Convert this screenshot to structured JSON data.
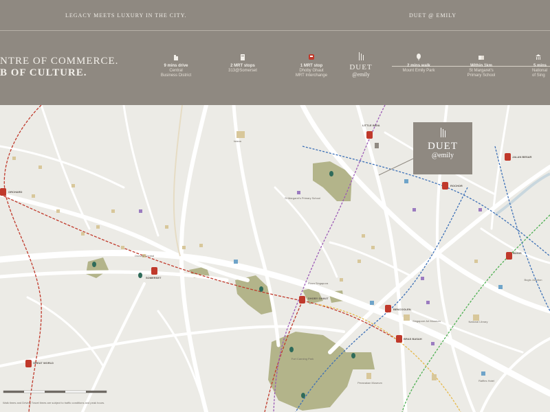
{
  "header": {
    "tagline": "LEGACY MEETS LUXURY IN THE CITY.",
    "brand": "DUET @ EMILY"
  },
  "band": {
    "headline_line1": "NTRE OF COMMERCE.",
    "headline_line2": "B OF CULTURE.",
    "logo_main": "DUET",
    "logo_sub": "@emily",
    "features": [
      {
        "icon": "building-icon",
        "line1": "9 mins drive",
        "line2": "Central",
        "line3": "Business District"
      },
      {
        "icon": "building-icon",
        "line1": "2 MRT stops",
        "line2": "313@Somerset",
        "line3": ""
      },
      {
        "icon": "train-icon",
        "line1": "1 MRT stop",
        "line2": "Dhoby Ghaut",
        "line3": "MRT Interchange"
      },
      {
        "icon": "pin-icon",
        "line1": "2 mins walk",
        "line2": "Mount Emily Park",
        "line3": ""
      },
      {
        "icon": "book-icon",
        "line1": "Within 1km",
        "line2": "St Margaret's",
        "line3": "Primary School"
      },
      {
        "icon": "museum-icon",
        "line1": "5 mins",
        "line2": "National",
        "line3": "of Sing"
      }
    ]
  },
  "callout": {
    "main": "DUET",
    "sub": "@emily"
  },
  "stations": [
    {
      "name": "ORCHARD"
    },
    {
      "name": "SOMERSET"
    },
    {
      "name": "DHOBY GHAUT"
    },
    {
      "name": "LITTLE INDIA"
    },
    {
      "name": "ROCHOR"
    },
    {
      "name": "JALAN BESAR"
    },
    {
      "name": "BUGIS"
    },
    {
      "name": "BENCOOLEN"
    },
    {
      "name": "BRAS BASAH"
    },
    {
      "name": "GREAT WORLD"
    }
  ],
  "places": [
    {
      "name": "Istana"
    },
    {
      "name": "St Margaret's Primary School"
    },
    {
      "name": "Orchard Central"
    },
    {
      "name": "Singapore Art Museum"
    },
    {
      "name": "National Library"
    },
    {
      "name": "Bugis Junction"
    },
    {
      "name": "Peranakan Museum"
    },
    {
      "name": "Fort Canning Park"
    },
    {
      "name": "Plaza Singapura"
    },
    {
      "name": "Raffles Hotel"
    }
  ],
  "legend": {
    "text": "Walk times and Driving Travel times are subject to traffic conditions and peak hours."
  },
  "colors": {
    "band": "#8f8981",
    "map_bg": "#ecebe6",
    "road": "#ffffff",
    "park": "#b3b48a",
    "line_red": "#c0392b",
    "line_purple": "#9b59b6",
    "line_blue": "#3b6fb6",
    "line_green": "#4caf50",
    "line_yellow": "#e6b94a"
  }
}
